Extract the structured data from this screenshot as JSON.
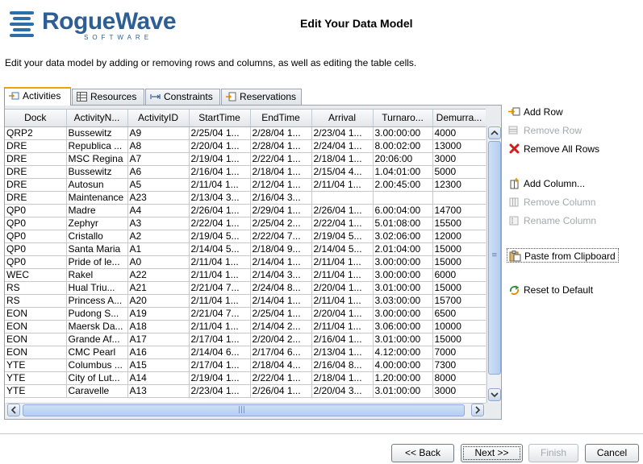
{
  "brand": {
    "name": "RogueWave",
    "tagline": "SOFTWARE"
  },
  "page": {
    "title": "Edit Your Data Model",
    "description": "Edit your data model by adding or removing rows and columns, as well as editing the table cells."
  },
  "tabs": [
    {
      "label": "Activities",
      "icon": "activities-icon",
      "active": true
    },
    {
      "label": "Resources",
      "icon": "table-icon",
      "active": false
    },
    {
      "label": "Constraints",
      "icon": "link-arrows-icon",
      "active": false
    },
    {
      "label": "Reservations",
      "icon": "reservations-icon",
      "active": false
    }
  ],
  "table": {
    "columns": [
      "Dock",
      "ActivityN...",
      "ActivityID",
      "StartTime",
      "EndTime",
      "Arrival",
      "Turnaro...",
      "Demurra..."
    ],
    "rows": [
      [
        "QRP2",
        "Bussewitz",
        "A9",
        "2/25/04 1...",
        "2/28/04 1...",
        "2/23/04 1...",
        "3.00:00:00",
        "4000"
      ],
      [
        "DRE",
        "Republica ...",
        "A8",
        "2/20/04 1...",
        "2/28/04 1...",
        "2/24/04 1...",
        "8.00:02:00",
        "13000"
      ],
      [
        "DRE",
        "MSC Regina",
        "A7",
        "2/19/04 1...",
        "2/22/04 1...",
        "2/18/04 1...",
        "20:06:00",
        "3000"
      ],
      [
        "DRE",
        "Bussewitz",
        "A6",
        "2/16/04 1...",
        "2/18/04 1...",
        "2/15/04 4...",
        "1.04:01:00",
        "5000"
      ],
      [
        "DRE",
        "Autosun",
        "A5",
        "2/11/04 1...",
        "2/12/04 1...",
        "2/11/04 1...",
        "2.00:45:00",
        "12300"
      ],
      [
        "DRE",
        "Maintenance",
        "A23",
        "2/13/04 3...",
        "2/16/04 3...",
        "",
        "",
        ""
      ],
      [
        "QP0",
        "Madre",
        "A4",
        "2/26/04 1...",
        "2/29/04 1...",
        "2/26/04 1...",
        "6.00:04:00",
        "14700"
      ],
      [
        "QP0",
        "Zephyr",
        "A3",
        "2/22/04 1...",
        "2/25/04 2...",
        "2/22/04 1...",
        "5.01:08:00",
        "15500"
      ],
      [
        "QP0",
        "Cristallo",
        "A2",
        "2/19/04 5...",
        "2/22/04 7...",
        "2/19/04 5...",
        "3.02:06:00",
        "12000"
      ],
      [
        "QP0",
        "Santa Maria",
        "A1",
        "2/14/04 5...",
        "2/18/04 9...",
        "2/14/04 5...",
        "2.01:04:00",
        "15000"
      ],
      [
        "QP0",
        "Pride of le...",
        "A0",
        "2/11/04 1...",
        "2/14/04 1...",
        "2/11/04 1...",
        "3.00:00:00",
        "15000"
      ],
      [
        "WEC",
        "Rakel",
        "A22",
        "2/11/04 1...",
        "2/14/04 3...",
        "2/11/04 1...",
        "3.00:00:00",
        "6000"
      ],
      [
        "RS",
        "Hual Triu...",
        "A21",
        "2/21/04 7...",
        "2/24/04 8...",
        "2/20/04 1...",
        "3.01:00:00",
        "15000"
      ],
      [
        "RS",
        "Princess A...",
        "A20",
        "2/11/04 1...",
        "2/14/04 1...",
        "2/11/04 1...",
        "3.03:00:00",
        "15700"
      ],
      [
        "EON",
        "Pudong S...",
        "A19",
        "2/21/04 7...",
        "2/25/04 1...",
        "2/20/04 1...",
        "3.00:00:00",
        "6500"
      ],
      [
        "EON",
        "Maersk Da...",
        "A18",
        "2/11/04 1...",
        "2/14/04 2...",
        "2/11/04 1...",
        "3.06:00:00",
        "10000"
      ],
      [
        "EON",
        "Grande Af...",
        "A17",
        "2/17/04 1...",
        "2/20/04 2...",
        "2/16/04 1...",
        "3.01:00:00",
        "15000"
      ],
      [
        "EON",
        "CMC Pearl",
        "A16",
        "2/14/04 6...",
        "2/17/04 6...",
        "2/13/04 1...",
        "4.12:00:00",
        "7000"
      ],
      [
        "YTE",
        "Columbus ...",
        "A15",
        "2/17/04 1...",
        "2/18/04 4...",
        "2/16/04 8...",
        "4.00:00:00",
        "7300"
      ],
      [
        "YTE",
        "City of Lut...",
        "A14",
        "2/19/04 1...",
        "2/22/04 1...",
        "2/18/04 1...",
        "1.20:00:00",
        "8000"
      ],
      [
        "YTE",
        "Caravelle",
        "A13",
        "2/23/04 1...",
        "2/26/04 1...",
        "2/20/04 3...",
        "3.01:00:00",
        "3000"
      ]
    ]
  },
  "actions": [
    {
      "label": "Add Row",
      "icon": "add-row-icon",
      "enabled": true
    },
    {
      "label": "Remove Row",
      "icon": "remove-row-icon",
      "enabled": false
    },
    {
      "label": "Remove All Rows",
      "icon": "red-x-icon",
      "enabled": true
    },
    {
      "label": "Add Column...",
      "icon": "add-column-icon",
      "enabled": true
    },
    {
      "label": "Remove Column",
      "icon": "remove-column-icon",
      "enabled": false
    },
    {
      "label": "Rename Column",
      "icon": "rename-column-icon",
      "enabled": false
    },
    {
      "label": "Paste from Clipboard",
      "icon": "paste-icon",
      "enabled": true
    },
    {
      "label": "Reset to Default",
      "icon": "reset-icon",
      "enabled": true
    }
  ],
  "buttons": {
    "back": "<< Back",
    "next": "Next >>",
    "finish": "Finish",
    "cancel": "Cancel"
  },
  "colors": {
    "brand": "#2d5f95",
    "tab_accent": "#f0a300",
    "scrollbar": "#b4cdef"
  }
}
